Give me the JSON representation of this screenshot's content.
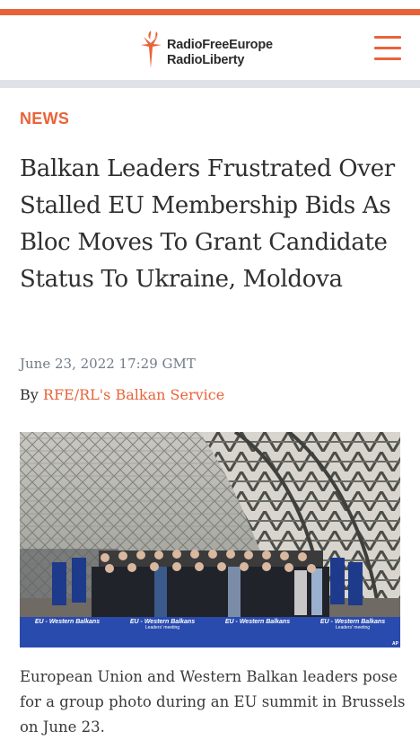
{
  "header": {
    "logo_line1": "RadioFreeEurope",
    "logo_line2": "RadioLiberty",
    "logo_icon": "torch-icon",
    "menu_icon": "hamburger-menu-icon",
    "accent_color": "#e9633a"
  },
  "article": {
    "kicker": "NEWS",
    "headline": "Balkan Leaders Frustrated Over Stalled EU Membership Bids As Bloc Moves To Grant Candidate Status To Ukraine, Moldova",
    "date": "June 23, 2022 17:29 GMT",
    "byline_prefix": "By",
    "author": "RFE/RL's Balkan Service",
    "photo": {
      "banner_texts": [
        "EU - Western Balkans",
        "EU - Western Balkans",
        "EU - Western Balkans",
        "EU - Western Balkans"
      ],
      "banner_subtexts": [
        "",
        "Leaders' meeting",
        "",
        "Leaders' meeting"
      ],
      "credit": "AP"
    },
    "caption": "European Union and Western Balkan leaders pose for a group photo during an EU summit in Brussels on June 23."
  }
}
